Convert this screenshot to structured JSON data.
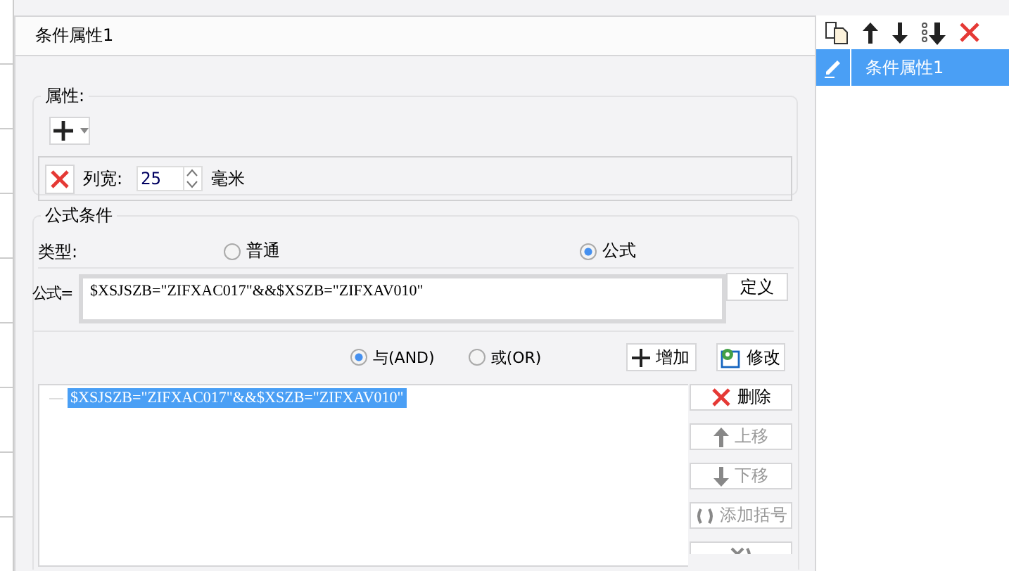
{
  "dialog": {
    "title": "条件属性1"
  },
  "attributes": {
    "legend": "属性:",
    "column_width": {
      "label": "列宽:",
      "value": "25",
      "unit": "毫米"
    }
  },
  "formula_condition": {
    "legend": "公式条件",
    "type_label": "类型:",
    "types": [
      {
        "label": "普通",
        "selected": false
      },
      {
        "label": "公式",
        "selected": true
      }
    ],
    "formula_label": "公式=",
    "formula": "$XSJSZB=\"ZIFXAC017\"&&$XSZB=\"ZIFXAV010\"",
    "define_button": "定义",
    "logic": [
      {
        "label": "与(AND)",
        "selected": true
      },
      {
        "label": "或(OR)",
        "selected": false
      }
    ],
    "add_button": "增加",
    "modify_button": "修改",
    "conditions": [
      {
        "text": "$XSJSZB=\"ZIFXAC017\"&&$XSZB=\"ZIFXAV010\"",
        "selected": true
      }
    ],
    "side_buttons": [
      {
        "kind": "delete",
        "label": "删除",
        "disabled": false
      },
      {
        "kind": "up",
        "label": "上移",
        "disabled": true
      },
      {
        "kind": "down",
        "label": "下移",
        "disabled": true
      },
      {
        "kind": "brackets",
        "label": "添加括号",
        "disabled": true
      },
      {
        "kind": "unbracket",
        "disabled": true
      }
    ]
  },
  "condition_list": {
    "items": [
      {
        "label": "条件属性1",
        "selected": true
      }
    ]
  }
}
